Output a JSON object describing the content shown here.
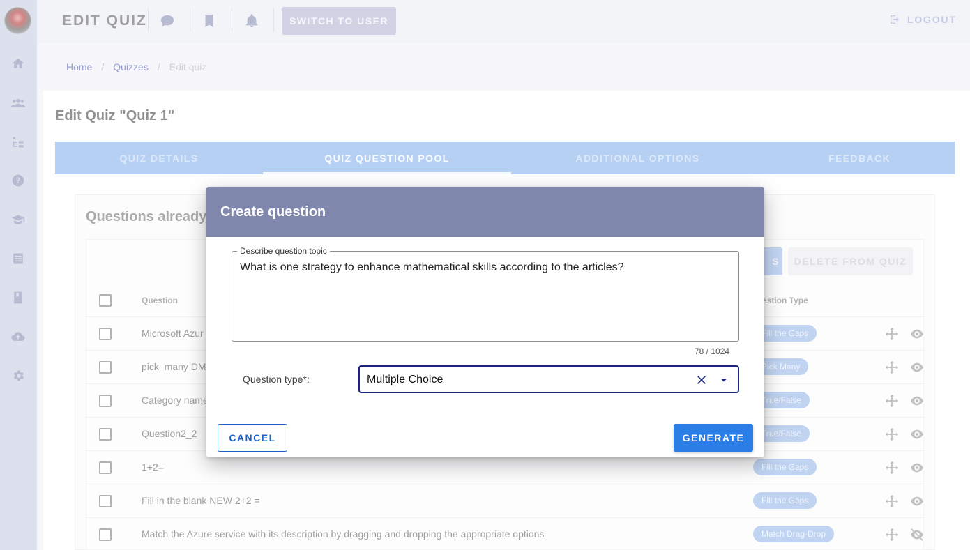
{
  "header": {
    "title": "EDIT QUIZ",
    "switch_label": "SWITCH TO USER",
    "logout_label": "LOGOUT",
    "icons": [
      "chat-icon",
      "bookmark-icon",
      "bell-icon"
    ]
  },
  "sidebar": {
    "icons": [
      "home-icon",
      "users-icon",
      "hierarchy-icon",
      "help-icon",
      "graduation-cap-icon",
      "list-icon",
      "book-icon",
      "cloud-upload-icon",
      "gear-icon"
    ]
  },
  "breadcrumb": {
    "home": "Home",
    "quizzes": "Quizzes",
    "current": "Edit quiz",
    "separator": "/"
  },
  "page": {
    "title": "Edit Quiz \"Quiz 1\""
  },
  "tabs": [
    {
      "label": "QUIZ DETAILS",
      "active": false
    },
    {
      "label": "QUIZ QUESTION POOL",
      "active": true
    },
    {
      "label": "ADDITIONAL OPTIONS",
      "active": false
    },
    {
      "label": "FEEDBACK",
      "active": false
    }
  ],
  "pool": {
    "title": "Questions already a",
    "partial_button": "S",
    "delete_button": "DELETE FROM QUIZ",
    "columns": {
      "question": "Question",
      "type": "estion Type"
    },
    "rows": [
      {
        "question": "Microsoft Azur",
        "type": "Fill the Gaps"
      },
      {
        "question": "pick_many DM",
        "type": "Pick Many"
      },
      {
        "question": "Category name",
        "type": "True/False"
      },
      {
        "question": "Question2_2",
        "type": "True/False"
      },
      {
        "question": "1+2=",
        "type": "Fill the Gaps"
      },
      {
        "question": "Fill in the blank NEW 2+2 =",
        "type": "Fill the Gaps"
      },
      {
        "question": "Match the Azure service with its description by dragging and dropping the appropriate options",
        "type": "Match Drag-Drop"
      }
    ]
  },
  "modal": {
    "title": "Create question",
    "topic_label": "Describe question topic",
    "topic_value": "What is one strategy to enhance mathematical skills according to the articles?",
    "counter": "78 / 1024",
    "type_label": "Question type*:",
    "type_value": "Multiple Choice",
    "cancel_label": "CANCEL",
    "generate_label": "GENERATE"
  },
  "colors": {
    "accent": "#2b7ee6",
    "modal_header": "#7f87ad",
    "tabs_bg": "#a6c6f2",
    "sidebar_bg": "#d6d9ea"
  }
}
